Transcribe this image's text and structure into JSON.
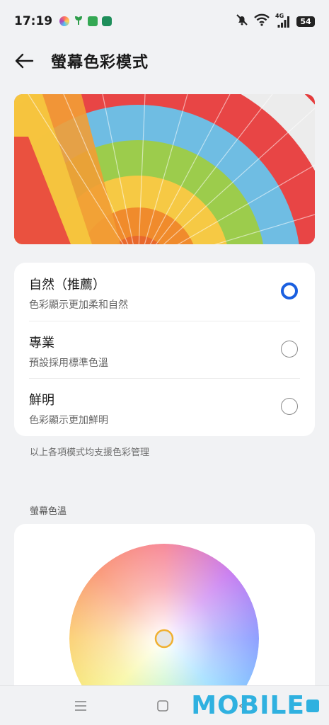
{
  "status": {
    "time": "17:19",
    "network": "4G",
    "battery": "54"
  },
  "header": {
    "title": "螢幕色彩模式"
  },
  "modes": [
    {
      "title": "自然（推薦）",
      "desc": "色彩顯示更加柔和自然",
      "selected": true
    },
    {
      "title": "專業",
      "desc": "預設採用標準色溫",
      "selected": false
    },
    {
      "title": "鮮明",
      "desc": "色彩顯示更加鮮明",
      "selected": false
    }
  ],
  "hint": "以上各項模式均支援色彩管理",
  "temperature": {
    "label": "螢幕色溫"
  },
  "watermark": {
    "text": "MOBILE"
  },
  "colors": {
    "accent": "#1a5fe0",
    "background": "#f1f2f4",
    "watermark": "#2fb1e0"
  },
  "icons": [
    "back-arrow-icon",
    "mute-bell-icon",
    "wifi-icon",
    "signal-icon",
    "battery-icon",
    "menu-icon",
    "home-icon",
    "back-triangle-icon"
  ]
}
